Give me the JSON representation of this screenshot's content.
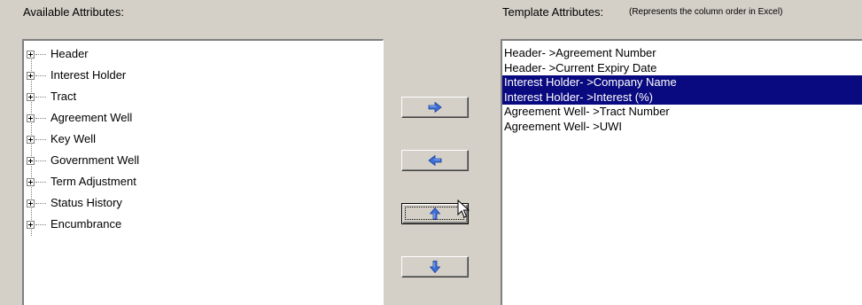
{
  "available": {
    "label": "Available Attributes:",
    "items": [
      "Header",
      "Interest Holder",
      "Tract",
      "Agreement Well",
      "Key Well",
      "Government Well",
      "Term Adjustment",
      "Status History",
      "Encumbrance"
    ]
  },
  "template": {
    "label": "Template Attributes:",
    "note": "(Represents the column order in Excel)",
    "items": [
      {
        "text": "Header- >Agreement Number",
        "selected": false
      },
      {
        "text": "Header- >Current Expiry Date",
        "selected": false
      },
      {
        "text": "Interest Holder- >Company Name",
        "selected": true
      },
      {
        "text": "Interest Holder- >Interest (%)",
        "selected": true
      },
      {
        "text": "Agreement Well- >Tract Number",
        "selected": false
      },
      {
        "text": "Agreement Well- >UWI",
        "selected": false
      }
    ]
  },
  "buttons": {
    "add": "right-arrow-icon",
    "remove": "left-arrow-icon",
    "move_up": "up-arrow-icon",
    "move_down": "down-arrow-icon"
  },
  "colors": {
    "background": "#d4d0c8",
    "selection": "#0a0a80",
    "arrow_fill": "#3d6fd6",
    "arrow_light": "#9ec0ff"
  }
}
